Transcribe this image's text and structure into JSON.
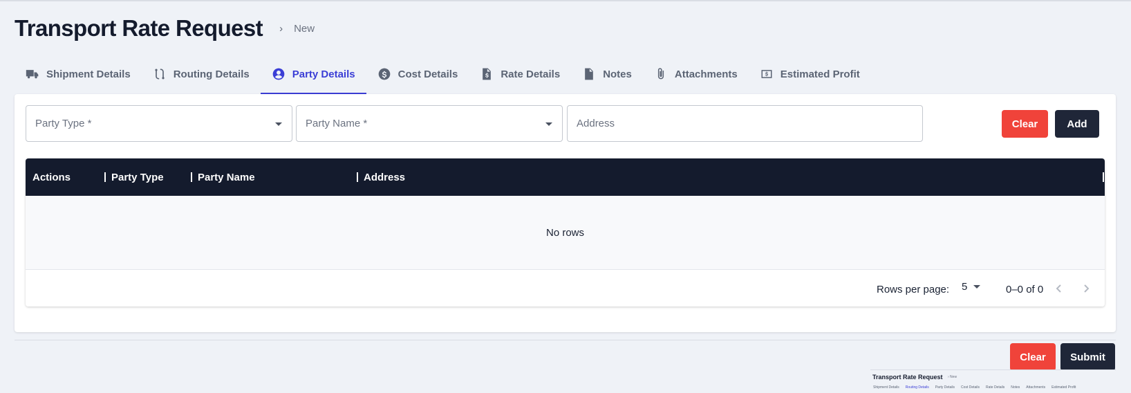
{
  "page": {
    "title": "Transport Rate Request",
    "breadcrumb_separator": "›",
    "breadcrumb_current": "New"
  },
  "tabs": [
    {
      "label": "Shipment Details",
      "icon": "truck-icon",
      "active": false
    },
    {
      "label": "Routing Details",
      "icon": "route-icon",
      "active": false
    },
    {
      "label": "Party Details",
      "icon": "user-circle-icon",
      "active": true
    },
    {
      "label": "Cost Details",
      "icon": "dollar-circle-icon",
      "active": false
    },
    {
      "label": "Rate Details",
      "icon": "invoice-dollar-icon",
      "active": false
    },
    {
      "label": "Notes",
      "icon": "note-icon",
      "active": false
    },
    {
      "label": "Attachments",
      "icon": "paperclip-icon",
      "active": false
    },
    {
      "label": "Estimated Profit",
      "icon": "money-bill-icon",
      "active": false
    }
  ],
  "form": {
    "party_type_placeholder": "Party Type *",
    "party_name_placeholder": "Party Name *",
    "address_placeholder": "Address",
    "clear_label": "Clear",
    "add_label": "Add"
  },
  "grid": {
    "columns": [
      "Actions",
      "Party Type",
      "Party Name",
      "Address"
    ],
    "rows": [],
    "empty_text": "No rows",
    "rows_per_page_label": "Rows per page:",
    "rows_per_page_value": "5",
    "range_text": "0–0 of 0"
  },
  "footer": {
    "clear_label": "Clear",
    "submit_label": "Submit"
  },
  "thumbnail": {
    "title": "Transport Rate Request",
    "breadcrumb": "› New",
    "tabs": [
      "Shipment Details",
      "Routing Details",
      "Party Details",
      "Cost Details",
      "Rate Details",
      "Notes",
      "Attachments",
      "Estimated Profit"
    ]
  },
  "colors": {
    "accent": "#3b3ed6",
    "danger": "#f0433a",
    "dark": "#1f2638",
    "grid_header": "#141b2d",
    "background": "#eff2f7"
  }
}
